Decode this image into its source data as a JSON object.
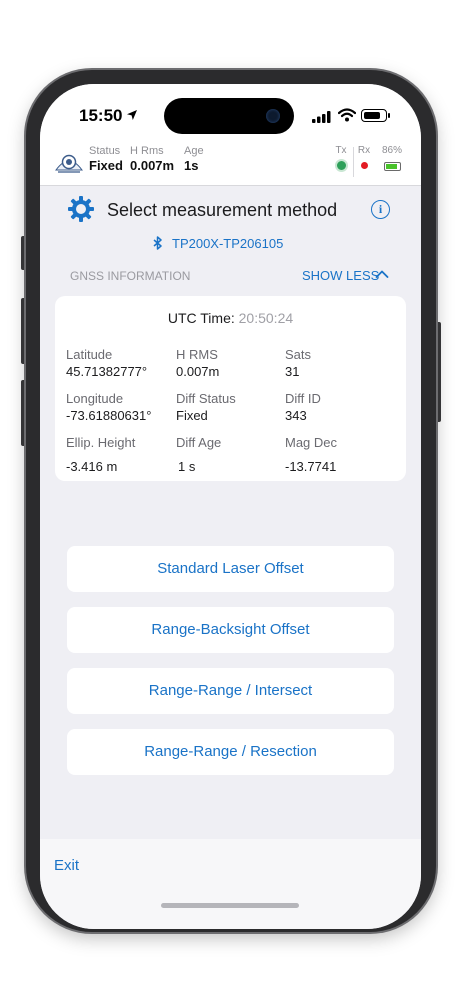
{
  "status_bar": {
    "time": "15:50"
  },
  "gnss_status": {
    "status_label": "Status",
    "status_value": "Fixed",
    "hrms_label": "H Rms",
    "hrms_value": "0.007m",
    "age_label": "Age",
    "age_value": "1s",
    "tx_label": "Tx",
    "rx_label": "Rx",
    "battery_label": "86%",
    "battery_level": 0.86,
    "tx_color": "#2ea05a",
    "rx_color": "#e31b23"
  },
  "header": {
    "title": "Select measurement method",
    "device": "TP200X-TP206105",
    "accent_color": "#1a73c7"
  },
  "section": {
    "label": "GNSS INFORMATION",
    "toggle_label": "SHOW LESS"
  },
  "gnss_info": {
    "utc_label": "UTC Time:",
    "utc_value": "20:50:24",
    "cells": [
      {
        "label": "Latitude",
        "value": "45.71382777°"
      },
      {
        "label": "H RMS",
        "value": "0.007m"
      },
      {
        "label": "Sats",
        "value": "31"
      },
      {
        "label": "Longitude",
        "value": "-73.61880631°"
      },
      {
        "label": "Diff Status",
        "value": "Fixed"
      },
      {
        "label": "Diff ID",
        "value": "343"
      },
      {
        "label": "Ellip. Height",
        "value": "-3.416 m"
      },
      {
        "label": "Diff Age",
        "value": "1 s"
      },
      {
        "label": "Mag Dec",
        "value": "-13.7741"
      }
    ]
  },
  "methods": [
    {
      "label": "Standard Laser Offset"
    },
    {
      "label": "Range-Backsight Offset"
    },
    {
      "label": "Range-Range / Intersect"
    },
    {
      "label": "Range-Range / Resection"
    }
  ],
  "footer": {
    "exit_label": "Exit"
  }
}
